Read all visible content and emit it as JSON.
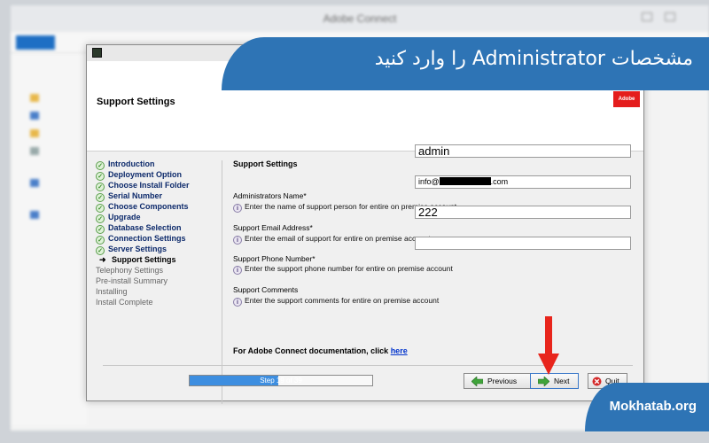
{
  "background_window": {
    "title": "Adobe Connect"
  },
  "installer": {
    "header_title": "Support Settings",
    "brand_badge": "Adobe",
    "steps": [
      {
        "label": "Introduction",
        "state": "done"
      },
      {
        "label": "Deployment Option",
        "state": "done"
      },
      {
        "label": "Choose Install Folder",
        "state": "done"
      },
      {
        "label": "Serial Number",
        "state": "done"
      },
      {
        "label": "Choose Components",
        "state": "done"
      },
      {
        "label": "Upgrade",
        "state": "done"
      },
      {
        "label": "Database Selection",
        "state": "done"
      },
      {
        "label": "Connection Settings",
        "state": "done"
      },
      {
        "label": "Server Settings",
        "state": "done"
      },
      {
        "label": "Support Settings",
        "state": "current"
      },
      {
        "label": "Telephony Settings",
        "state": "pending"
      },
      {
        "label": "Pre-install Summary",
        "state": "pending"
      },
      {
        "label": "Installing",
        "state": "pending"
      },
      {
        "label": "Install Complete",
        "state": "pending"
      }
    ],
    "panel_title": "Support Settings",
    "fields": {
      "admin_name": {
        "label": "Administrators Name*",
        "value": "admin",
        "hint": "Enter the name of support person for entire on premise account"
      },
      "support_email": {
        "label": "Support Email Address*",
        "value_prefix": "info@",
        "value_suffix": ".com",
        "hint": "Enter the email of support for entire on premise account"
      },
      "support_phone": {
        "label": "Support Phone Number*",
        "value": "222",
        "hint": "Enter the support phone number for entire on premise account"
      },
      "support_comments": {
        "label": "Support Comments",
        "value": "",
        "hint": "Enter the support comments for entire on premise account"
      }
    },
    "doc_text": "For Adobe Connect documentation, click ",
    "doc_link": "here",
    "progress": {
      "text": "Step 19 of 39",
      "current": 19,
      "total": 39
    },
    "buttons": {
      "previous": "Previous",
      "next": "Next",
      "quit": "Quit"
    }
  },
  "overlay": {
    "title_fa": "مشخصات Administrator را وارد کنید",
    "site": "Mokhatab.org",
    "accent_color": "#2e74b5",
    "arrow_color": "#e8251c"
  }
}
